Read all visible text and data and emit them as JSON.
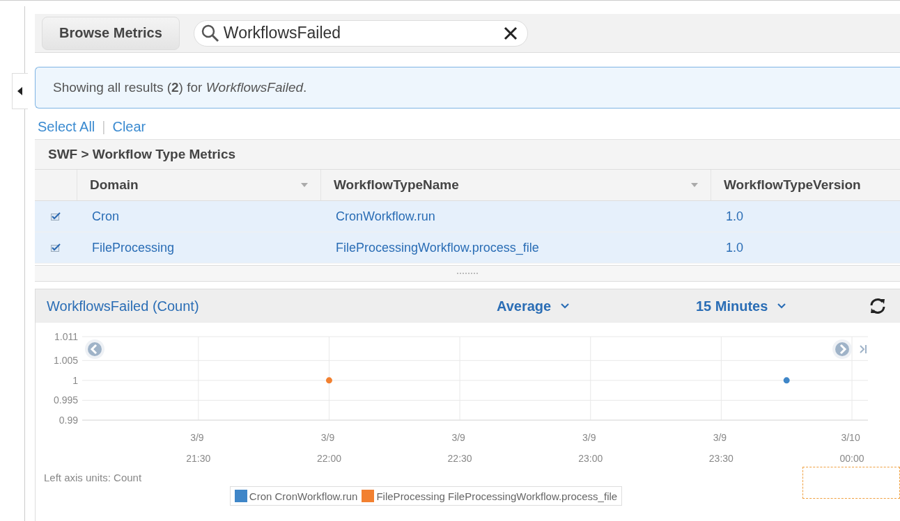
{
  "toolbar": {
    "browse_button": "Browse Metrics",
    "search": {
      "value": "WorkflowsFailed"
    }
  },
  "info": "Showing all results (**2**) for *WorkflowsFailed*.",
  "links": [
    {
      "label": "Select All"
    },
    {
      "label": "Clear"
    }
  ],
  "link_separator": "|",
  "group_title": "SWF > Workflow Type Metrics",
  "table": {
    "columns": [
      {
        "label": "Domain",
        "menu": true
      },
      {
        "label": "WorkflowTypeName",
        "menu": true
      },
      {
        "label": "WorkflowTypeVersion",
        "menu": false
      }
    ],
    "rows": [
      {
        "checked": true,
        "selected": true,
        "cells": [
          "Cron",
          "CronWorkflow.run",
          "1.0"
        ]
      },
      {
        "checked": true,
        "selected": true,
        "cells": [
          "FileProcessing",
          "FileProcessingWorkflow.process_file",
          "1.0"
        ]
      }
    ]
  },
  "graph": {
    "title": "WorkflowsFailed (Count)",
    "statistic": "Average",
    "period": "15 Minutes",
    "axis_units": "Left axis units:  Count",
    "chart_data": {
      "type": "scatter",
      "categories": [
        null,
        "3/9 21:30",
        null,
        "3/9 22:00",
        null,
        "3/9 22:30",
        null,
        "3/9 23:00",
        null,
        "3/9 23:30",
        null,
        "3/10 00:00"
      ],
      "series": [
        {
          "name": "Cron CronWorkflow.run",
          "color": "#3f86c8",
          "values": [
            null,
            null,
            null,
            null,
            null,
            null,
            null,
            null,
            null,
            null,
            1,
            null
          ]
        },
        {
          "name": "FileProcessing FileProcessingWorkflow.process_file",
          "color": "#f28030",
          "values": [
            null,
            null,
            null,
            1,
            null,
            null,
            null,
            null,
            null,
            null,
            null,
            null
          ]
        }
      ],
      "grid": true,
      "ylim": [
        0.99,
        1.011
      ],
      "yticks": [
        {
          "value": 0.99,
          "label": "0.99"
        },
        {
          "value": 0.995,
          "label": "0.995"
        },
        {
          "value": 1,
          "label": "1"
        },
        {
          "value": 1.005,
          "label": "1.005"
        },
        {
          "value": 1.011,
          "label": "1.011"
        }
      ]
    }
  }
}
